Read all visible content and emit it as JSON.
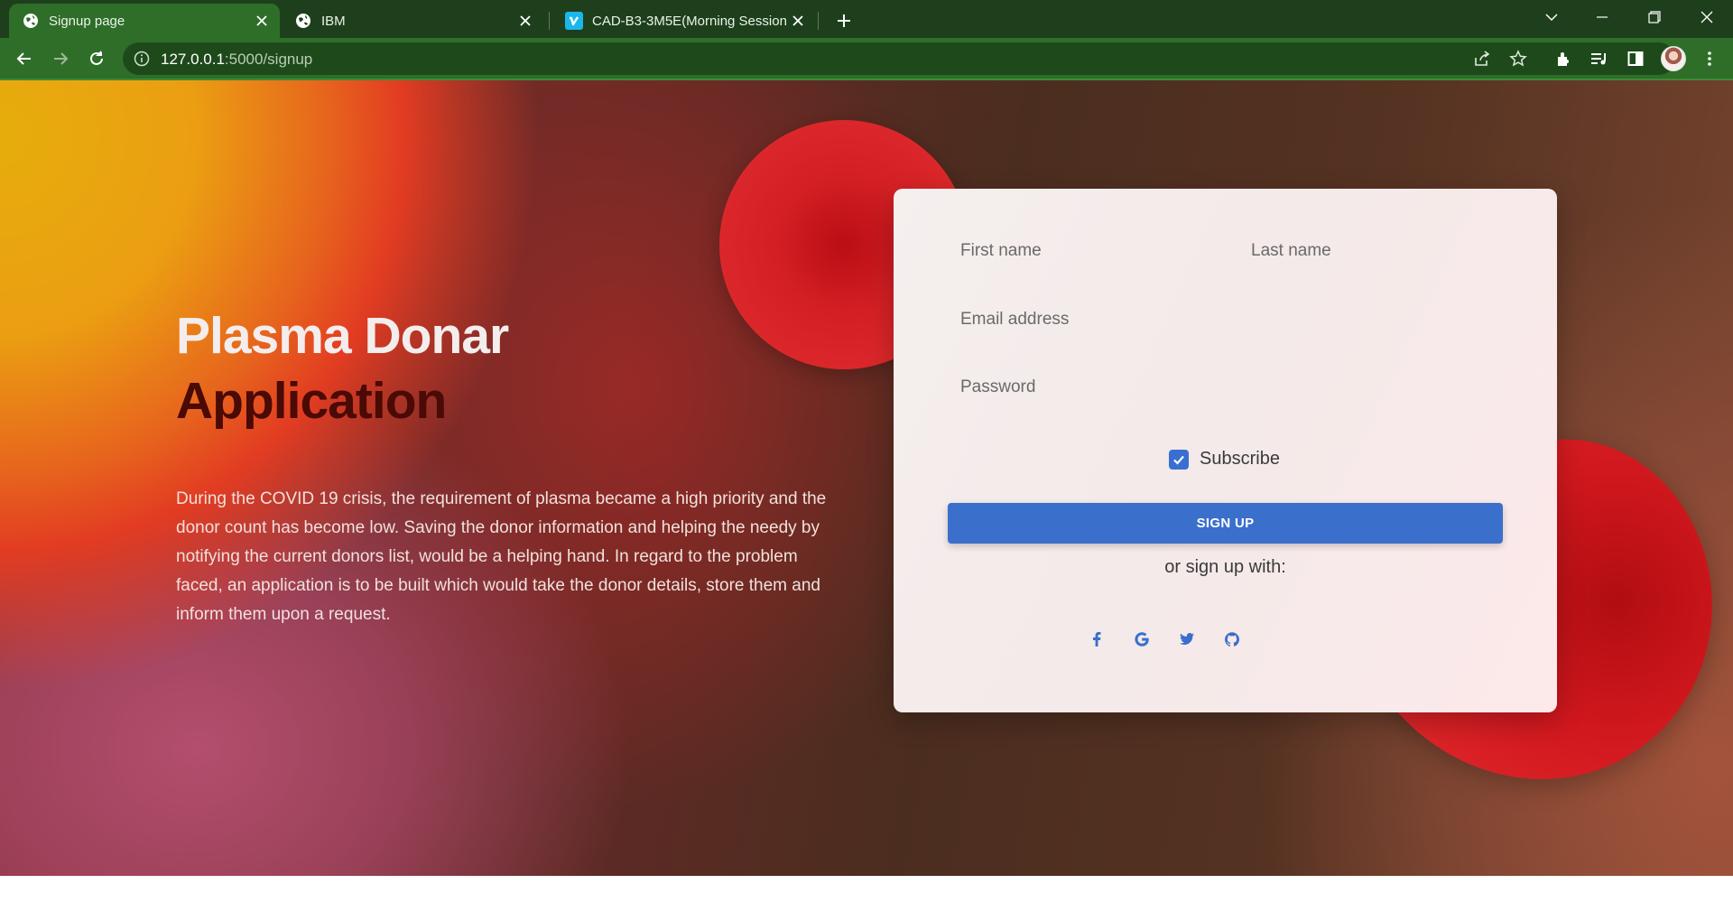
{
  "browser": {
    "tabs": [
      {
        "title": "Signup page",
        "icon": "globe-icon",
        "active": true
      },
      {
        "title": "IBM",
        "icon": "globe-icon",
        "active": false
      },
      {
        "title": "CAD-B3-3M5E(Morning Session)",
        "icon": "vimeo-icon",
        "active": false
      }
    ],
    "url": {
      "host": "127.0.0.1",
      "path": ":5000/signup"
    },
    "colors": {
      "frame": "#1e3f1c",
      "toolbar": "#2e6e29"
    }
  },
  "hero": {
    "title_line1": "Plasma Donar",
    "title_line2": "Application",
    "description": "During the COVID 19 crisis, the requirement of plasma became a high priority and the donor count has become low. Saving the donor information and helping the needy by notifying the current donors list, would be a helping hand. In regard to the problem faced, an application is to be built which would take the donor details, store them and inform them upon a request."
  },
  "form": {
    "first_name_placeholder": "First name",
    "last_name_placeholder": "Last name",
    "email_placeholder": "Email address",
    "password_placeholder": "Password",
    "subscribe_label": "Subscribe",
    "subscribe_checked": true,
    "submit_label": "SIGN UP",
    "social_prompt": "or sign up with:",
    "social_icons": [
      "facebook-icon",
      "google-icon",
      "twitter-icon",
      "github-icon"
    ],
    "accent_color": "#3a6fcb"
  }
}
